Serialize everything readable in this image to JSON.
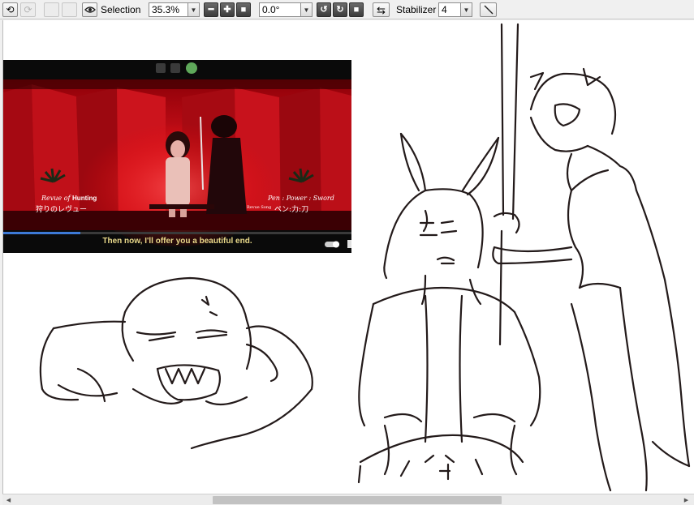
{
  "toolbar": {
    "undo": "undo-icon",
    "redo": "redo-icon",
    "view_toggle": "eye-icon",
    "selection_label": "Selection",
    "zoom_value": "35.3%",
    "zoom_out": "minus-icon",
    "zoom_in": "plus-icon",
    "zoom_reset": "square-icon",
    "rotation_value": "0.0°",
    "rotate_ccw": "rotate-left-icon",
    "rotate_cw": "rotate-right-icon",
    "rotate_reset": "square-icon",
    "flip": "flip-horizontal-icon",
    "stabilizer_label": "Stabilizer",
    "stabilizer_value": "4",
    "line_tool": "diagonal-line-icon"
  },
  "reference_image": {
    "subtitle": "Then now, I'll offer you a beautiful end.",
    "left_caption_prefix": "Revue of",
    "left_caption_bold": "Hunting",
    "left_caption_jp": "狩りのレヴュー",
    "right_caption": "Pen : Power : Sword",
    "right_caption_small": "Revue Song",
    "right_caption_jp": "ペン:力:刀"
  },
  "colors": {
    "toolbar_bg": "#f0f0f0",
    "canvas_bg": "#ffffff",
    "stroke": "#231a1a",
    "scene_red": "#c4101a"
  }
}
